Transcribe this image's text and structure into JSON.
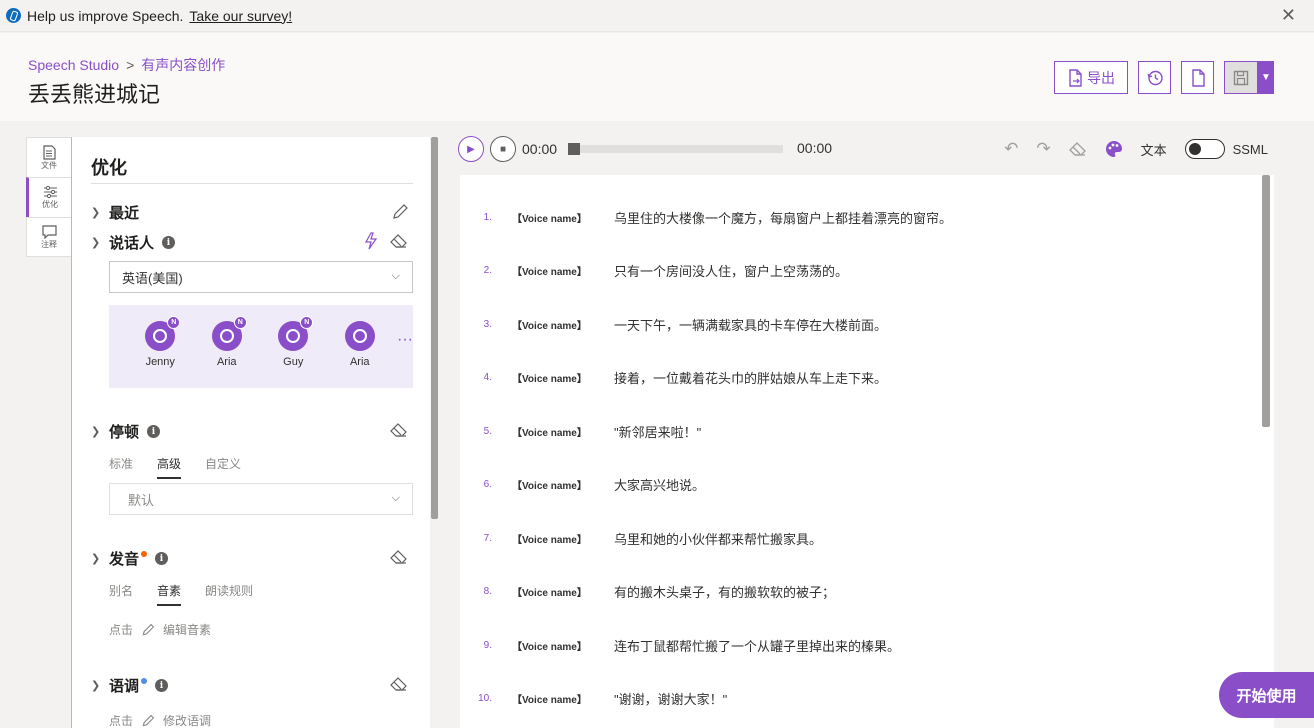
{
  "banner": {
    "text": "Help us improve Speech.",
    "link": "Take our survey!",
    "close": "✕"
  },
  "header": {
    "breadcrumb": [
      "Speech Studio",
      "有声内容创作"
    ],
    "breadcrumb_sep": ">",
    "title": "丢丢熊进城记",
    "export_label": "导出"
  },
  "side_tabs": [
    {
      "label": "文件",
      "icon": "document-icon"
    },
    {
      "label": "优化",
      "icon": "sliders-icon"
    },
    {
      "label": "注释",
      "icon": "comment-icon"
    }
  ],
  "panel": {
    "title": "优化",
    "recent": {
      "label": "最近"
    },
    "speaker": {
      "label": "说话人",
      "language": "英语(美国)",
      "voices": [
        {
          "name": "Jenny",
          "badge": "N"
        },
        {
          "name": "Aria",
          "badge": "N"
        },
        {
          "name": "Guy",
          "badge": "N"
        },
        {
          "name": "Aria",
          "badge": ""
        }
      ],
      "more": "···"
    },
    "pause": {
      "label": "停顿",
      "tabs": [
        "标准",
        "高级",
        "自定义"
      ],
      "active_tab": 1,
      "value": "默认"
    },
    "pronunciation": {
      "label": "发音",
      "dot_color": "#f7630c",
      "tabs": [
        "别名",
        "音素",
        "朗读规则"
      ],
      "active_tab": 1,
      "hint_click": "点击",
      "hint_action": "编辑音素"
    },
    "intonation": {
      "label": "语调",
      "dot_color": "#4f8fe8",
      "hint_click": "点击",
      "hint_action": "修改语调"
    }
  },
  "player": {
    "time_current": "00:00",
    "time_total": "00:00",
    "progress": 0
  },
  "editor_tools": {
    "text_label": "文本",
    "ssml_label": "SSML"
  },
  "lines": [
    {
      "num": "1.",
      "voice": "【Voice name】",
      "text": "乌里住的大楼像一个魔方，每扇窗户上都挂着漂亮的窗帘。"
    },
    {
      "num": "2.",
      "voice": "【Voice name】",
      "text": "只有一个房间没人住，窗户上空荡荡的。"
    },
    {
      "num": "3.",
      "voice": "【Voice name】",
      "text": "一天下午，一辆满载家具的卡车停在大楼前面。"
    },
    {
      "num": "4.",
      "voice": "【Voice name】",
      "text": "接着，一位戴着花头巾的胖姑娘从车上走下来。"
    },
    {
      "num": "5.",
      "voice": "【Voice name】",
      "text": "\"新邻居来啦！\""
    },
    {
      "num": "6.",
      "voice": "【Voice name】",
      "text": "大家高兴地说。"
    },
    {
      "num": "7.",
      "voice": "【Voice name】",
      "text": "乌里和她的小伙伴都来帮忙搬家具。"
    },
    {
      "num": "8.",
      "voice": "【Voice name】",
      "text": "有的搬木头桌子，有的搬软软的被子；"
    },
    {
      "num": "9.",
      "voice": "【Voice name】",
      "text": "连布丁鼠都帮忙搬了一个从罐子里掉出来的榛果。"
    },
    {
      "num": "10.",
      "voice": "【Voice name】",
      "text": "\"谢谢，谢谢大家！\""
    }
  ],
  "start_button": "开始使用",
  "colors": {
    "accent": "#8a4fc8"
  }
}
